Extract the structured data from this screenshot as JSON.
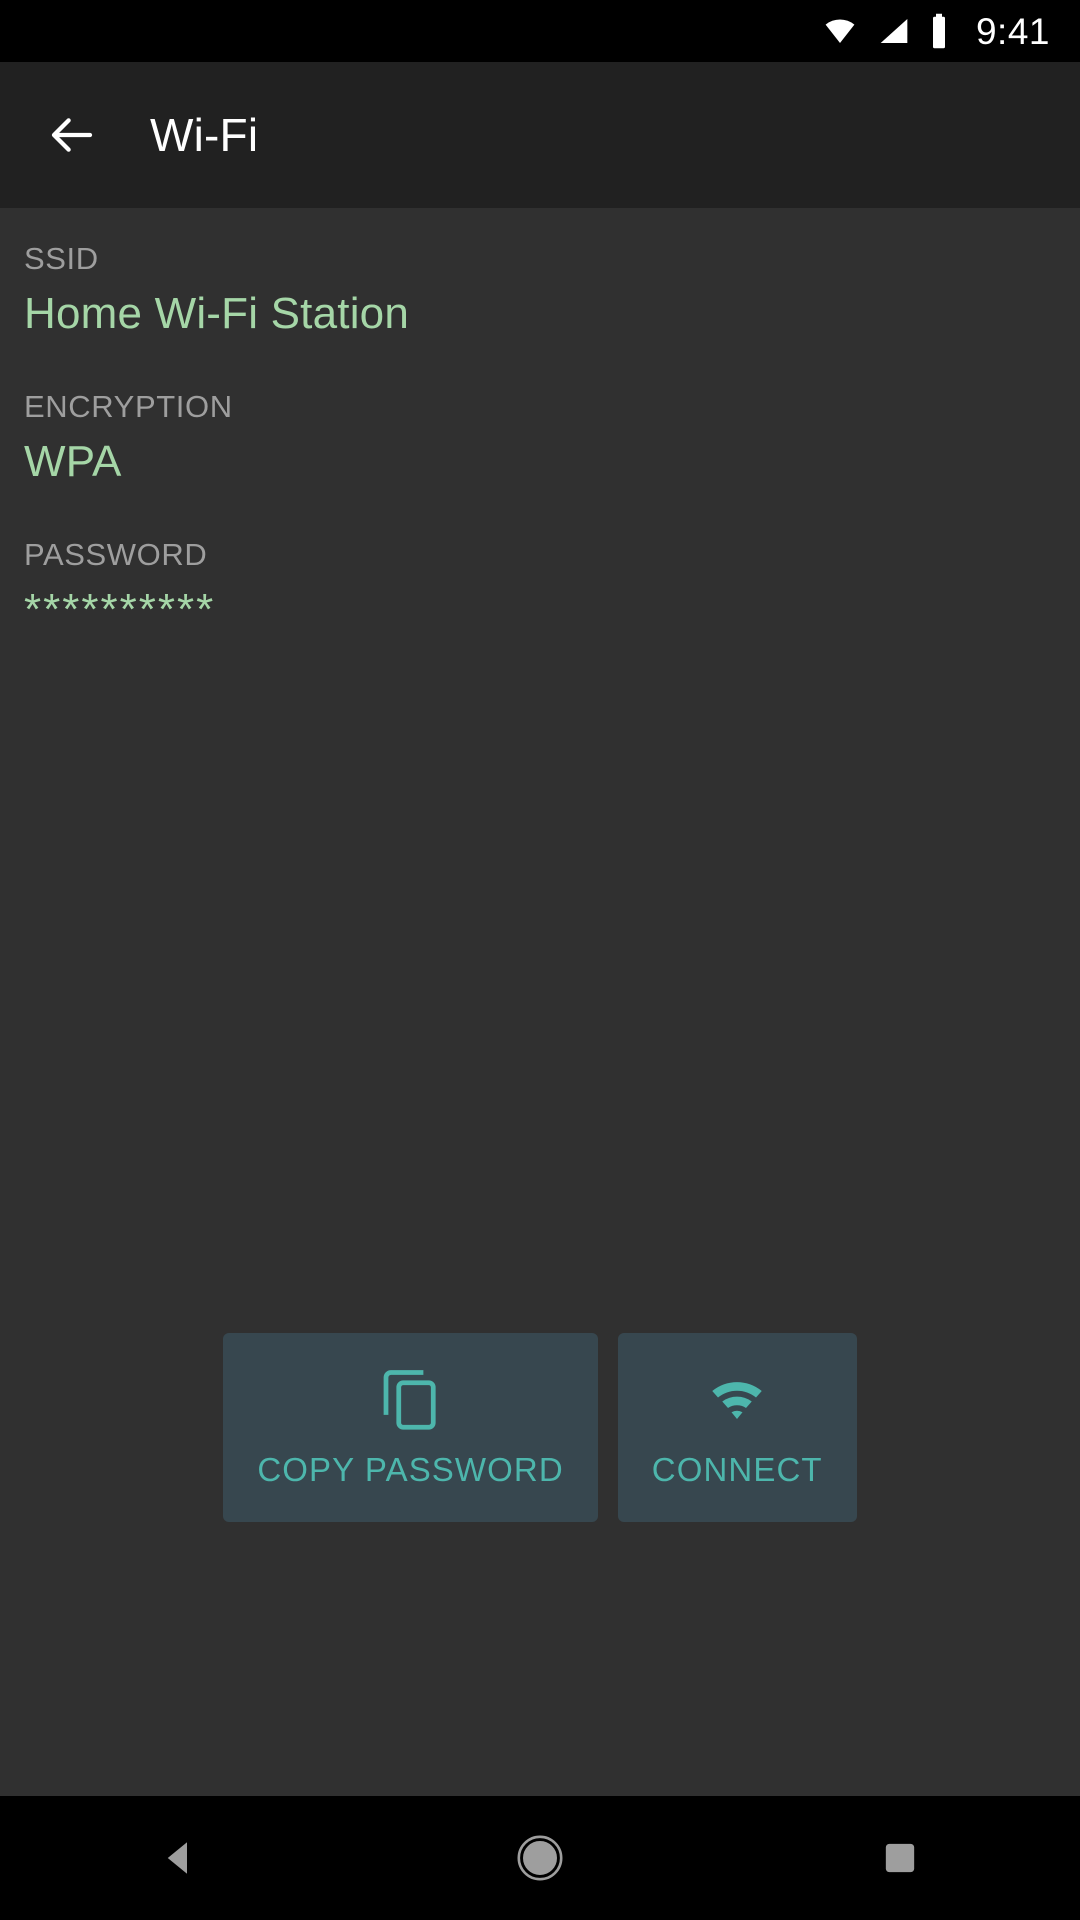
{
  "status_bar": {
    "time": "9:41",
    "icons": [
      "wifi-icon",
      "cellular-signal-icon",
      "battery-icon"
    ]
  },
  "app_bar": {
    "back_icon": "back-arrow-icon",
    "title": "Wi-Fi"
  },
  "fields": [
    {
      "label": "SSID",
      "value": "Home Wi-Fi Station"
    },
    {
      "label": "ENCRYPTION",
      "value": "WPA"
    },
    {
      "label": "PASSWORD",
      "value": "**********"
    }
  ],
  "actions": [
    {
      "label": "COPY PASSWORD",
      "icon": "copy-icon"
    },
    {
      "label": "CONNECT",
      "icon": "wifi-icon"
    }
  ],
  "nav_bar": {
    "back": "nav-back-triangle-icon",
    "home": "nav-home-circle-icon",
    "recents": "nav-recents-square-icon"
  },
  "colors": {
    "status_bar_bg": "#000000",
    "app_bar_bg": "#212121",
    "content_bg": "#303030",
    "label": "#9e9e9e",
    "value_green": "#a5d6a7",
    "button_bg": "#37474f",
    "accent_teal": "#4db6ac",
    "nav_bar_bg": "#000000",
    "nav_glyph": "#9e9e9e"
  }
}
